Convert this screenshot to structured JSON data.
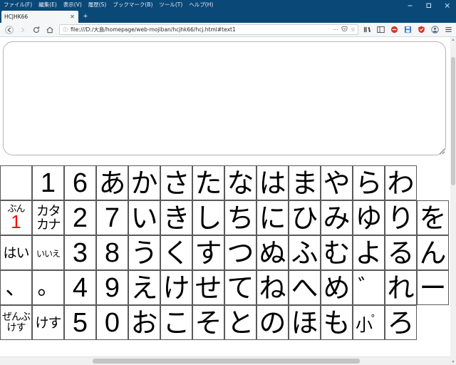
{
  "window": {
    "menus": [
      "ファイル(F)",
      "編集(E)",
      "表示(V)",
      "履歴(S)",
      "ブックマーク(B)",
      "ツール(T)",
      "ヘルプ(H)"
    ],
    "controls": {
      "minimize": "minimize-icon",
      "maximize": "maximize-icon",
      "close": "close-icon"
    },
    "titlebar_color": "#0a4878"
  },
  "tabs": {
    "items": [
      {
        "title": "HCJHK66",
        "close_label": "✕"
      }
    ],
    "new_tab_label": "+"
  },
  "navigation": {
    "back": "back-icon",
    "forward": "forward-icon",
    "reload": "reload-icon",
    "home": "home-icon",
    "url": "file:///D:/大島/homepage/web-mojiban/hcjhk66/hcj.html#text1",
    "identity_icon": "ⓘ",
    "page_actions": "⋯",
    "pocket_icon": "pocket-icon",
    "bookmark_star": "☆",
    "toolbar_icons": [
      "library-icon",
      "sidebar-icon",
      "shield-red-icon",
      "save-disk-icon",
      "security-red-icon",
      "account-icon",
      "menu-hamburger-icon"
    ]
  },
  "page": {
    "textarea_value": "",
    "textarea_placeholder": "",
    "keyboard": {
      "rows": [
        [
          {
            "type": "empty",
            "label": ""
          },
          {
            "type": "num",
            "label": "1"
          },
          {
            "type": "num",
            "label": "6"
          },
          {
            "type": "kana",
            "label": "あ"
          },
          {
            "type": "kana",
            "label": "か"
          },
          {
            "type": "kana",
            "label": "さ"
          },
          {
            "type": "kana",
            "label": "た"
          },
          {
            "type": "kana",
            "label": "な"
          },
          {
            "type": "kana",
            "label": "は"
          },
          {
            "type": "kana",
            "label": "ま"
          },
          {
            "type": "kana",
            "label": "や"
          },
          {
            "type": "kana",
            "label": "ら"
          },
          {
            "type": "kana",
            "label": "わ"
          }
        ],
        [
          {
            "type": "func-red",
            "label": "ぶん",
            "value": "1"
          },
          {
            "type": "func2",
            "line1": "カタ",
            "line2": "カナ"
          },
          {
            "type": "num",
            "label": "2"
          },
          {
            "type": "num",
            "label": "7"
          },
          {
            "type": "kana",
            "label": "い"
          },
          {
            "type": "kana",
            "label": "き"
          },
          {
            "type": "kana",
            "label": "し"
          },
          {
            "type": "kana",
            "label": "ち"
          },
          {
            "type": "kana",
            "label": "に"
          },
          {
            "type": "kana",
            "label": "ひ"
          },
          {
            "type": "kana",
            "label": "み"
          },
          {
            "type": "kana",
            "label": "ゆ"
          },
          {
            "type": "kana",
            "label": "り"
          },
          {
            "type": "kana",
            "label": "を"
          }
        ],
        [
          {
            "type": "func-mid",
            "label": "はい"
          },
          {
            "type": "func-small",
            "label": "いいえ"
          },
          {
            "type": "num",
            "label": "3"
          },
          {
            "type": "num",
            "label": "8"
          },
          {
            "type": "kana",
            "label": "う"
          },
          {
            "type": "kana",
            "label": "く"
          },
          {
            "type": "kana",
            "label": "す"
          },
          {
            "type": "kana",
            "label": "つ"
          },
          {
            "type": "kana",
            "label": "ぬ"
          },
          {
            "type": "kana",
            "label": "ふ"
          },
          {
            "type": "kana",
            "label": "む"
          },
          {
            "type": "kana",
            "label": "よ"
          },
          {
            "type": "kana",
            "label": "る"
          },
          {
            "type": "kana",
            "label": "ん"
          }
        ],
        [
          {
            "type": "mark",
            "label": "、"
          },
          {
            "type": "mark",
            "label": "。"
          },
          {
            "type": "num",
            "label": "4"
          },
          {
            "type": "num",
            "label": "9"
          },
          {
            "type": "kana",
            "label": "え"
          },
          {
            "type": "kana",
            "label": "け"
          },
          {
            "type": "kana",
            "label": "せ"
          },
          {
            "type": "kana",
            "label": "て"
          },
          {
            "type": "kana",
            "label": "ね"
          },
          {
            "type": "kana",
            "label": "へ"
          },
          {
            "type": "kana",
            "label": "め"
          },
          {
            "type": "mark",
            "label": "゛"
          },
          {
            "type": "kana",
            "label": "れ"
          },
          {
            "type": "kana",
            "label": "ー"
          }
        ],
        [
          {
            "type": "func2s",
            "line1": "ぜんぶ",
            "line2": "けす"
          },
          {
            "type": "func-mid",
            "label": "けす"
          },
          {
            "type": "num",
            "label": "5"
          },
          {
            "type": "num",
            "label": "0"
          },
          {
            "type": "kana",
            "label": "お"
          },
          {
            "type": "kana",
            "label": "こ"
          },
          {
            "type": "kana",
            "label": "そ"
          },
          {
            "type": "kana",
            "label": "と"
          },
          {
            "type": "kana",
            "label": "の"
          },
          {
            "type": "kana",
            "label": "ほ"
          },
          {
            "type": "kana",
            "label": "も"
          },
          {
            "type": "handaku",
            "base": "小",
            "mark": "゜"
          },
          {
            "type": "kana",
            "label": "ろ"
          }
        ]
      ]
    }
  },
  "colors": {
    "chrome_blue": "#0a4878",
    "accent_red": "#ff0000",
    "cell_border": "#5a5a5a",
    "toolbar_bg": "#f5f6f7"
  }
}
